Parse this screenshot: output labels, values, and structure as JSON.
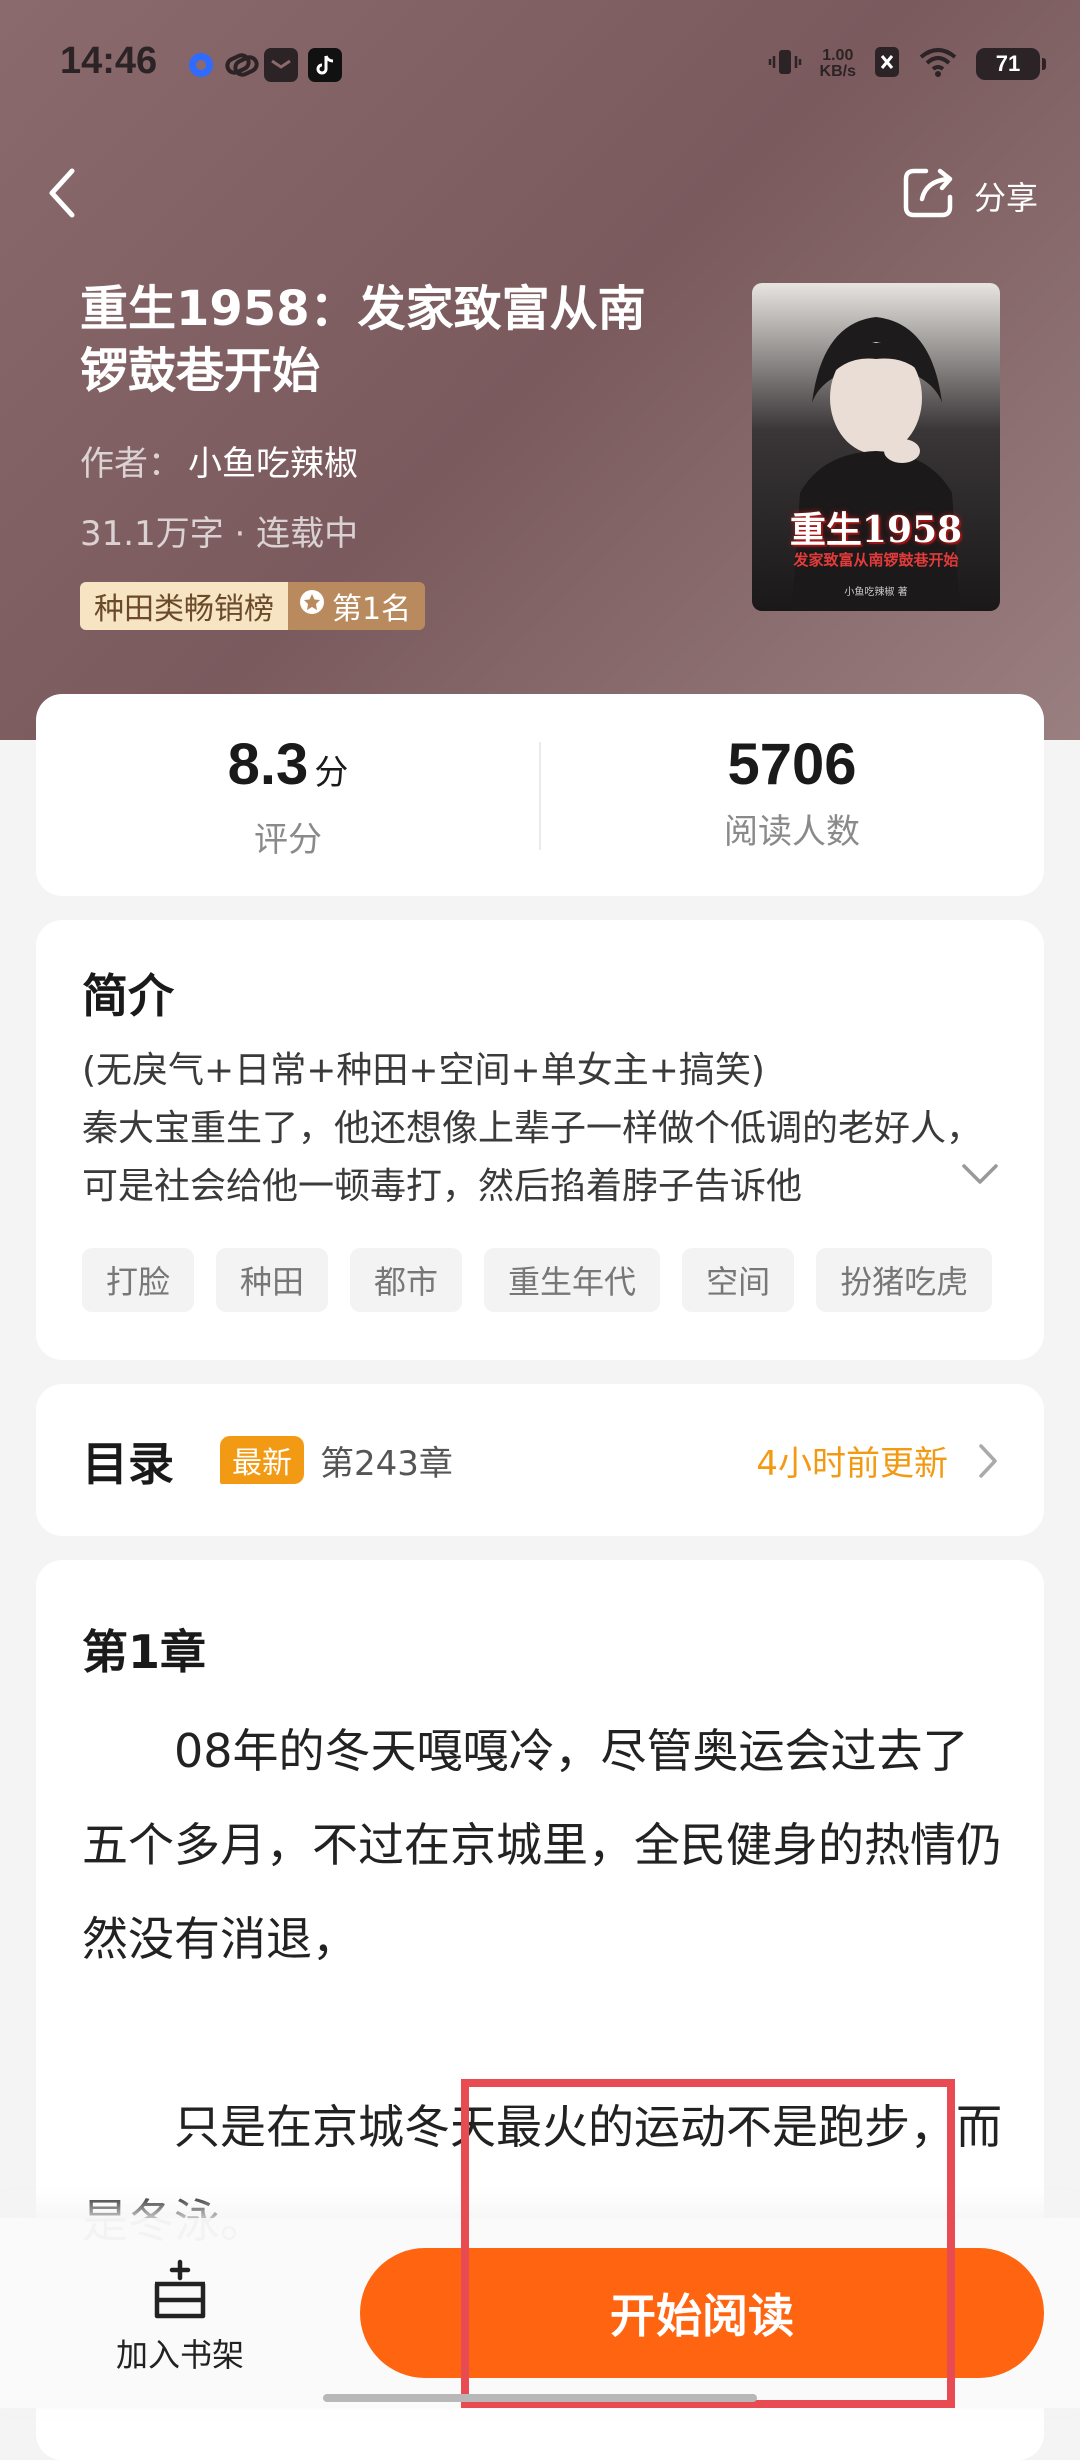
{
  "status_bar": {
    "time": "14:46",
    "net_speed_value": "1.00",
    "net_speed_unit": "KB/s",
    "battery": "71",
    "icons": [
      "notification-app-icon",
      "link-app-icon",
      "message-app-icon",
      "tiktok-icon",
      "vibrate-icon",
      "sim-icon",
      "wifi-icon",
      "battery-icon"
    ]
  },
  "header": {
    "back_icon": "chevron-left-icon",
    "share_label": "分享"
  },
  "book": {
    "title": "重生1958：发家致富从南锣鼓巷开始",
    "author_label": "作者：",
    "author": "小鱼吃辣椒",
    "meta": "31.1万字 · 连载中",
    "rank_category": "种田类畅销榜",
    "rank_position": "第1名",
    "cover": {
      "title": "重生1958",
      "subtitle": "发家致富从南锣鼓巷开始",
      "author": "小鱼吃辣椒 著"
    }
  },
  "stats": {
    "score": "8.3",
    "score_unit": "分",
    "score_label": "评分",
    "readers": "5706",
    "readers_label": "阅读人数"
  },
  "intro": {
    "title": "简介",
    "text": "(无戾气+日常+种田+空间+单女主+搞笑)\n秦大宝重生了，他还想像上辈子一样做个低调的老好人，可是社会给他一顿毒打，然后掐着脖子告诉他",
    "tags": [
      "打脸",
      "种田",
      "都市",
      "重生年代",
      "空间",
      "扮猪吃虎"
    ]
  },
  "toc": {
    "title": "目录",
    "badge": "最新",
    "latest_chapter": "第243章",
    "update_time": "4小时前更新"
  },
  "chapter": {
    "title": "第1章",
    "paragraphs": [
      "08年的冬天嘎嘎冷，尽管奥运会过去了五个多月，不过在京城里，全民健身的热情仍然没有消退，",
      "只是在京城冬天最火的运动不是跑步，而是冬泳。"
    ]
  },
  "bottom_bar": {
    "shelf_label": "加入书架",
    "read_label": "开始阅读"
  },
  "colors": {
    "accent_orange": "#ff6411",
    "update_orange": "#f39a14",
    "hero_bg": "#8a6a6c",
    "highlight_red": "#e84b52"
  }
}
